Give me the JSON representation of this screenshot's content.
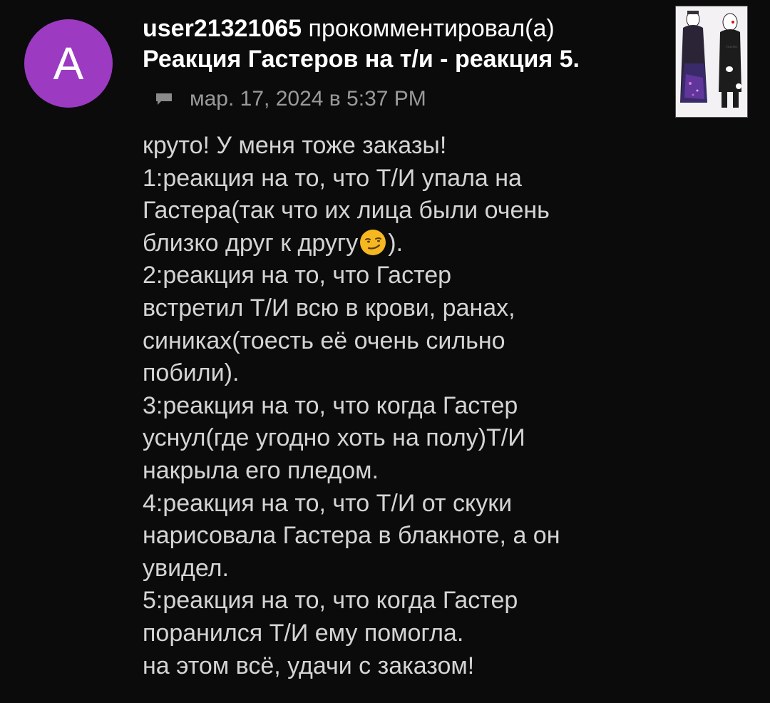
{
  "avatar": {
    "letter": "A",
    "color": "#9c3ac2"
  },
  "header": {
    "username": "user21321065",
    "action": " прокомментировал(а)",
    "post_title": "Реакция Гастеров на т/и - реакция 5."
  },
  "meta": {
    "timestamp": "мар. 17, 2024 в 5:37 PM",
    "icon": "comment-icon"
  },
  "thumbnail": {
    "icon": "artwork-thumbnail"
  },
  "comment": {
    "lines": [
      "круто! У меня тоже заказы!",
      "1:реакция на то, что Т/И упала на",
      "Гастера(так что их лица были очень",
      "близко друг к другу",
      ").",
      "2:реакция на то, что Гастер",
      "встретил Т/И всю в крови, ранах,",
      "синиках(тоесть её очень сильно",
      "побили).",
      "3:реакция на то, что когда Гастер",
      "уснул(где угодно хоть на полу)Т/И",
      "накрыла его пледом.",
      "4:реакция на то, что Т/И от скуки",
      "нарисовала Гастера в блакноте, а он",
      "увидел.",
      "5:реакция на то, что когда Гастер",
      "поранился Т/И ему помогла.",
      "на этом всё, удачи с заказом!"
    ],
    "emoji": "smirking-face-emoji"
  }
}
